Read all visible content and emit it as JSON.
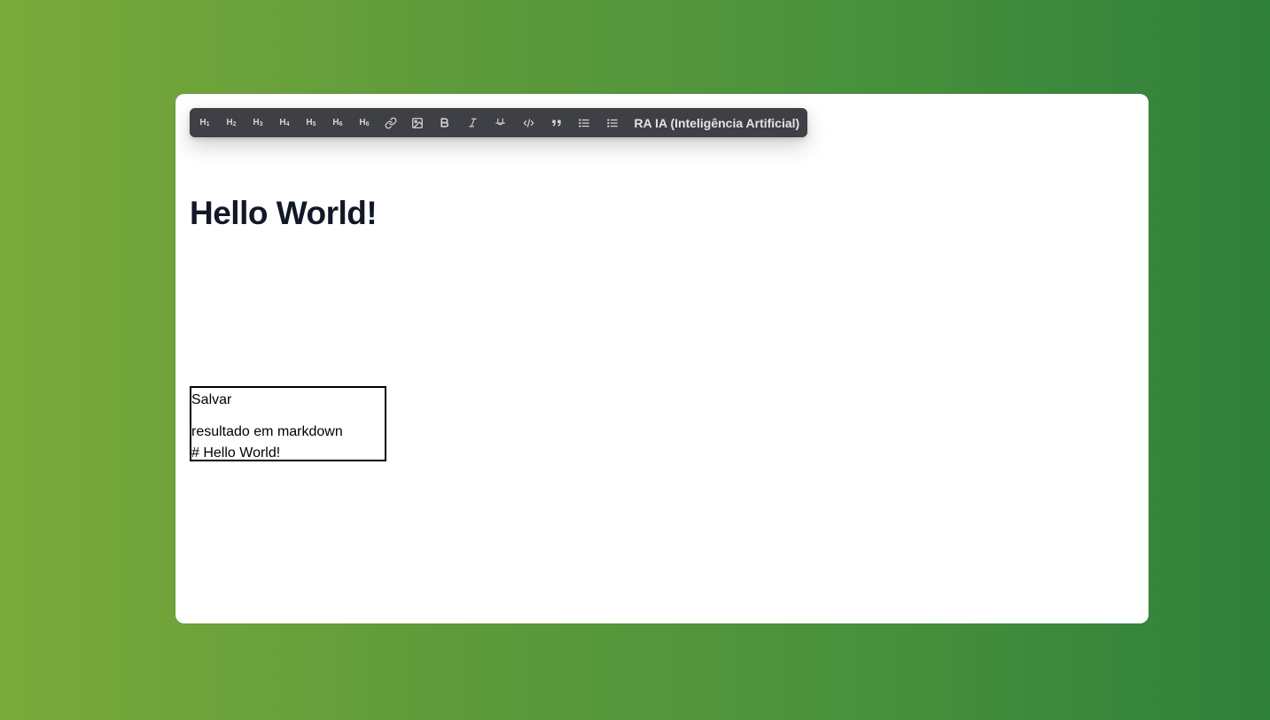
{
  "toolbar": {
    "headings": [
      {
        "main": "H",
        "sub": "1"
      },
      {
        "main": "H",
        "sub": "2"
      },
      {
        "main": "H",
        "sub": "3"
      },
      {
        "main": "H",
        "sub": "4"
      },
      {
        "main": "H",
        "sub": "5"
      },
      {
        "main": "H",
        "sub": "6"
      },
      {
        "main": "H",
        "sub": "6"
      }
    ],
    "ai_label": "RA IA (Inteligência Artificial)"
  },
  "editor": {
    "heading": "Hello World!"
  },
  "output": {
    "save_label": "Salvar",
    "result_label": "resultado em markdown",
    "markdown": "# Hello World!"
  },
  "colors": {
    "toolbar_bg": "#3f3f46",
    "heading_text": "#111827",
    "background_start": "#7aaa3b",
    "background_end": "#2f803b"
  }
}
